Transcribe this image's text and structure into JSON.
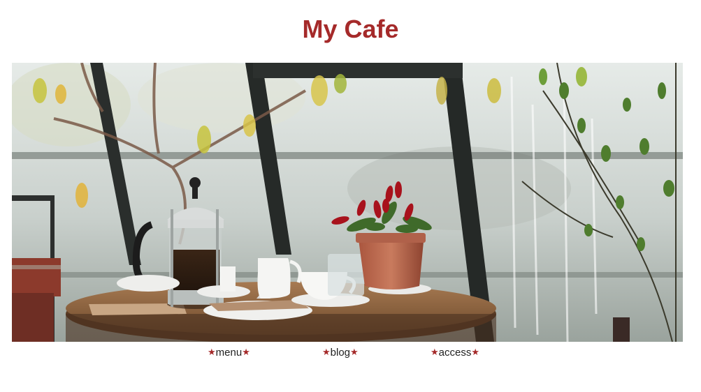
{
  "site": {
    "title": "My Cafe",
    "title_color": "#a52a2a"
  },
  "hero": {
    "image": "cafe-table-photo",
    "alt_description_hidden": ""
  },
  "nav": {
    "star_glyph": "★",
    "star_color": "#a52a2a",
    "items": [
      {
        "label": "menu"
      },
      {
        "label": "blog"
      },
      {
        "label": "access"
      }
    ]
  }
}
